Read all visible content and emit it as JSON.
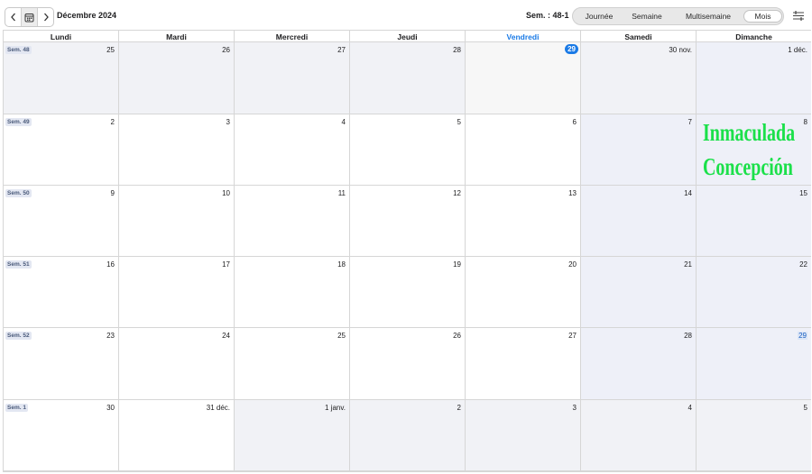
{
  "toolbar": {
    "prev_icon": "chevron-left-icon",
    "today_icon": "calendar-icon",
    "next_icon": "chevron-right-icon",
    "month_title": "Décembre 2024",
    "week_indicator": "Sem. : 48-1",
    "views": [
      {
        "label": "Journée",
        "active": false
      },
      {
        "label": "Semaine",
        "active": false
      },
      {
        "label": "Multisemaine",
        "active": false
      },
      {
        "label": "Mois",
        "active": true
      }
    ],
    "settings_icon": "sliders-icon"
  },
  "weekdays": [
    "Lundi",
    "Mardi",
    "Mercredi",
    "Jeudi",
    "Vendredi",
    "Samedi",
    "Dimanche"
  ],
  "today_weekday_index": 4,
  "weeks": [
    {
      "label": "Sem. 48",
      "days": [
        {
          "num": "25",
          "outside": true
        },
        {
          "num": "26",
          "outside": true
        },
        {
          "num": "27",
          "outside": true
        },
        {
          "num": "28",
          "outside": true
        },
        {
          "num": "29",
          "today": true
        },
        {
          "num": "30 nov.",
          "outside": true
        },
        {
          "num": "1 déc.",
          "weekend": true
        }
      ]
    },
    {
      "label": "Sem. 49",
      "days": [
        {
          "num": "2"
        },
        {
          "num": "3"
        },
        {
          "num": "4"
        },
        {
          "num": "5"
        },
        {
          "num": "6"
        },
        {
          "num": "7",
          "weekend": true
        },
        {
          "num": "8",
          "weekend": true
        }
      ]
    },
    {
      "label": "Sem. 50",
      "days": [
        {
          "num": "9"
        },
        {
          "num": "10"
        },
        {
          "num": "11"
        },
        {
          "num": "12"
        },
        {
          "num": "13"
        },
        {
          "num": "14",
          "weekend": true
        },
        {
          "num": "15",
          "weekend": true
        }
      ]
    },
    {
      "label": "Sem. 51",
      "days": [
        {
          "num": "16"
        },
        {
          "num": "17"
        },
        {
          "num": "18"
        },
        {
          "num": "19"
        },
        {
          "num": "20"
        },
        {
          "num": "21",
          "weekend": true
        },
        {
          "num": "22",
          "weekend": true
        }
      ]
    },
    {
      "label": "Sem. 52",
      "days": [
        {
          "num": "23"
        },
        {
          "num": "24"
        },
        {
          "num": "25"
        },
        {
          "num": "26"
        },
        {
          "num": "27"
        },
        {
          "num": "28",
          "weekend": true
        },
        {
          "num": "29",
          "weekend": true,
          "highlight": true
        }
      ]
    },
    {
      "label": "Sem. 1",
      "days": [
        {
          "num": "30"
        },
        {
          "num": "31 déc."
        },
        {
          "num": "1 janv.",
          "outside": true
        },
        {
          "num": "2",
          "outside": true
        },
        {
          "num": "3",
          "outside": true
        },
        {
          "num": "4",
          "outside": true
        },
        {
          "num": "5",
          "outside": true
        }
      ]
    }
  ],
  "event": {
    "title_line1": "Inmaculada",
    "title_line2": "Concepción",
    "color": "#1be04a"
  },
  "colors": {
    "accent": "#1a7ae6",
    "weekend_bg": "#eef0f8",
    "outside_bg": "#f1f2f6"
  }
}
